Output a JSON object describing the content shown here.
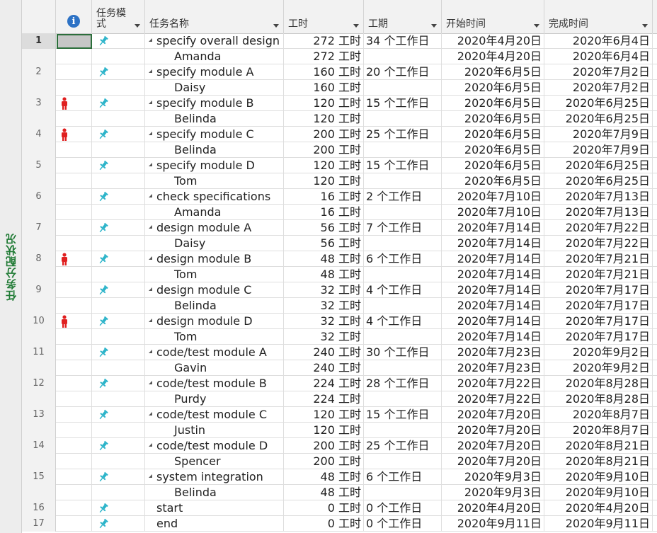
{
  "sidebar": {
    "view_label": "任务分配状况"
  },
  "header": {
    "indicator_icon": "info-icon",
    "mode_label": "任务模式",
    "name_label": "任务名称",
    "work_label": "工时",
    "duration_label": "工期",
    "start_label": "开始时间",
    "finish_label": "完成时间"
  },
  "colors": {
    "sidebar_text": "#1f7a34",
    "pin": "#2ab3c9",
    "person": "#e02020",
    "info": "#2d72c5"
  },
  "rows": [
    {
      "id": "1",
      "indicator": "",
      "mode_icon": "pin-icon",
      "name": "specify overall design",
      "work": "272 工时",
      "duration": "34 个工作日",
      "start": "2020年4月20日",
      "finish": "2020年6月4日",
      "type": "task",
      "selected": true
    },
    {
      "id": "",
      "indicator": "",
      "mode_icon": "",
      "name": "Amanda",
      "work": "272 工时",
      "duration": "",
      "start": "2020年4月20日",
      "finish": "2020年6月4日",
      "type": "resource"
    },
    {
      "id": "2",
      "indicator": "",
      "mode_icon": "pin-icon",
      "name": "specify module A",
      "work": "160 工时",
      "duration": "20 个工作日",
      "start": "2020年6月5日",
      "finish": "2020年7月2日",
      "type": "task"
    },
    {
      "id": "",
      "indicator": "",
      "mode_icon": "",
      "name": "Daisy",
      "work": "160 工时",
      "duration": "",
      "start": "2020年6月5日",
      "finish": "2020年7月2日",
      "type": "resource"
    },
    {
      "id": "3",
      "indicator": "person-icon",
      "mode_icon": "pin-icon",
      "name": "specify module B",
      "work": "120 工时",
      "duration": "15 个工作日",
      "start": "2020年6月5日",
      "finish": "2020年6月25日",
      "type": "task"
    },
    {
      "id": "",
      "indicator": "",
      "mode_icon": "",
      "name": "Belinda",
      "work": "120 工时",
      "duration": "",
      "start": "2020年6月5日",
      "finish": "2020年6月25日",
      "type": "resource"
    },
    {
      "id": "4",
      "indicator": "person-icon",
      "mode_icon": "pin-icon",
      "name": "specify module C",
      "work": "200 工时",
      "duration": "25 个工作日",
      "start": "2020年6月5日",
      "finish": "2020年7月9日",
      "type": "task"
    },
    {
      "id": "",
      "indicator": "",
      "mode_icon": "",
      "name": "Belinda",
      "work": "200 工时",
      "duration": "",
      "start": "2020年6月5日",
      "finish": "2020年7月9日",
      "type": "resource"
    },
    {
      "id": "5",
      "indicator": "",
      "mode_icon": "pin-icon",
      "name": "specify module D",
      "work": "120 工时",
      "duration": "15 个工作日",
      "start": "2020年6月5日",
      "finish": "2020年6月25日",
      "type": "task"
    },
    {
      "id": "",
      "indicator": "",
      "mode_icon": "",
      "name": "Tom",
      "work": "120 工时",
      "duration": "",
      "start": "2020年6月5日",
      "finish": "2020年6月25日",
      "type": "resource"
    },
    {
      "id": "6",
      "indicator": "",
      "mode_icon": "pin-icon",
      "name": "check specifications",
      "work": "16 工时",
      "duration": "2 个工作日",
      "start": "2020年7月10日",
      "finish": "2020年7月13日",
      "type": "task"
    },
    {
      "id": "",
      "indicator": "",
      "mode_icon": "",
      "name": "Amanda",
      "work": "16 工时",
      "duration": "",
      "start": "2020年7月10日",
      "finish": "2020年7月13日",
      "type": "resource"
    },
    {
      "id": "7",
      "indicator": "",
      "mode_icon": "pin-icon",
      "name": "design module A",
      "work": "56 工时",
      "duration": "7 个工作日",
      "start": "2020年7月14日",
      "finish": "2020年7月22日",
      "type": "task"
    },
    {
      "id": "",
      "indicator": "",
      "mode_icon": "",
      "name": "Daisy",
      "work": "56 工时",
      "duration": "",
      "start": "2020年7月14日",
      "finish": "2020年7月22日",
      "type": "resource"
    },
    {
      "id": "8",
      "indicator": "person-icon",
      "mode_icon": "pin-icon",
      "name": "design module B",
      "work": "48 工时",
      "duration": "6 个工作日",
      "start": "2020年7月14日",
      "finish": "2020年7月21日",
      "type": "task"
    },
    {
      "id": "",
      "indicator": "",
      "mode_icon": "",
      "name": "Tom",
      "work": "48 工时",
      "duration": "",
      "start": "2020年7月14日",
      "finish": "2020年7月21日",
      "type": "resource"
    },
    {
      "id": "9",
      "indicator": "",
      "mode_icon": "pin-icon",
      "name": "design module C",
      "work": "32 工时",
      "duration": "4 个工作日",
      "start": "2020年7月14日",
      "finish": "2020年7月17日",
      "type": "task"
    },
    {
      "id": "",
      "indicator": "",
      "mode_icon": "",
      "name": "Belinda",
      "work": "32 工时",
      "duration": "",
      "start": "2020年7月14日",
      "finish": "2020年7月17日",
      "type": "resource"
    },
    {
      "id": "10",
      "indicator": "person-icon",
      "mode_icon": "pin-icon",
      "name": "design module D",
      "work": "32 工时",
      "duration": "4 个工作日",
      "start": "2020年7月14日",
      "finish": "2020年7月17日",
      "type": "task"
    },
    {
      "id": "",
      "indicator": "",
      "mode_icon": "",
      "name": "Tom",
      "work": "32 工时",
      "duration": "",
      "start": "2020年7月14日",
      "finish": "2020年7月17日",
      "type": "resource"
    },
    {
      "id": "11",
      "indicator": "",
      "mode_icon": "pin-icon",
      "name": "code/test module A",
      "work": "240 工时",
      "duration": "30 个工作日",
      "start": "2020年7月23日",
      "finish": "2020年9月2日",
      "type": "task"
    },
    {
      "id": "",
      "indicator": "",
      "mode_icon": "",
      "name": "Gavin",
      "work": "240 工时",
      "duration": "",
      "start": "2020年7月23日",
      "finish": "2020年9月2日",
      "type": "resource"
    },
    {
      "id": "12",
      "indicator": "",
      "mode_icon": "pin-icon",
      "name": "code/test module B",
      "work": "224 工时",
      "duration": "28 个工作日",
      "start": "2020年7月22日",
      "finish": "2020年8月28日",
      "type": "task"
    },
    {
      "id": "",
      "indicator": "",
      "mode_icon": "",
      "name": "Purdy",
      "work": "224 工时",
      "duration": "",
      "start": "2020年7月22日",
      "finish": "2020年8月28日",
      "type": "resource"
    },
    {
      "id": "13",
      "indicator": "",
      "mode_icon": "pin-icon",
      "name": "code/test module C",
      "work": "120 工时",
      "duration": "15 个工作日",
      "start": "2020年7月20日",
      "finish": "2020年8月7日",
      "type": "task"
    },
    {
      "id": "",
      "indicator": "",
      "mode_icon": "",
      "name": "Justin",
      "work": "120 工时",
      "duration": "",
      "start": "2020年7月20日",
      "finish": "2020年8月7日",
      "type": "resource"
    },
    {
      "id": "14",
      "indicator": "",
      "mode_icon": "pin-icon",
      "name": "code/test module D",
      "work": "200 工时",
      "duration": "25 个工作日",
      "start": "2020年7月20日",
      "finish": "2020年8月21日",
      "type": "task"
    },
    {
      "id": "",
      "indicator": "",
      "mode_icon": "",
      "name": "Spencer",
      "work": "200 工时",
      "duration": "",
      "start": "2020年7月20日",
      "finish": "2020年8月21日",
      "type": "resource"
    },
    {
      "id": "15",
      "indicator": "",
      "mode_icon": "pin-icon",
      "name": "system integration",
      "work": "48 工时",
      "duration": "6 个工作日",
      "start": "2020年9月3日",
      "finish": "2020年9月10日",
      "type": "task"
    },
    {
      "id": "",
      "indicator": "",
      "mode_icon": "",
      "name": "Belinda",
      "work": "48 工时",
      "duration": "",
      "start": "2020年9月3日",
      "finish": "2020年9月10日",
      "type": "resource"
    },
    {
      "id": "16",
      "indicator": "",
      "mode_icon": "pin-icon",
      "name": "start",
      "work": "0 工时",
      "duration": "0 个工作日",
      "start": "2020年4月20日",
      "finish": "2020年4月20日",
      "type": "milestone"
    },
    {
      "id": "17",
      "indicator": "",
      "mode_icon": "pin-icon",
      "name": "end",
      "work": "0 工时",
      "duration": "0 个工作日",
      "start": "2020年9月11日",
      "finish": "2020年9月11日",
      "type": "milestone"
    }
  ]
}
